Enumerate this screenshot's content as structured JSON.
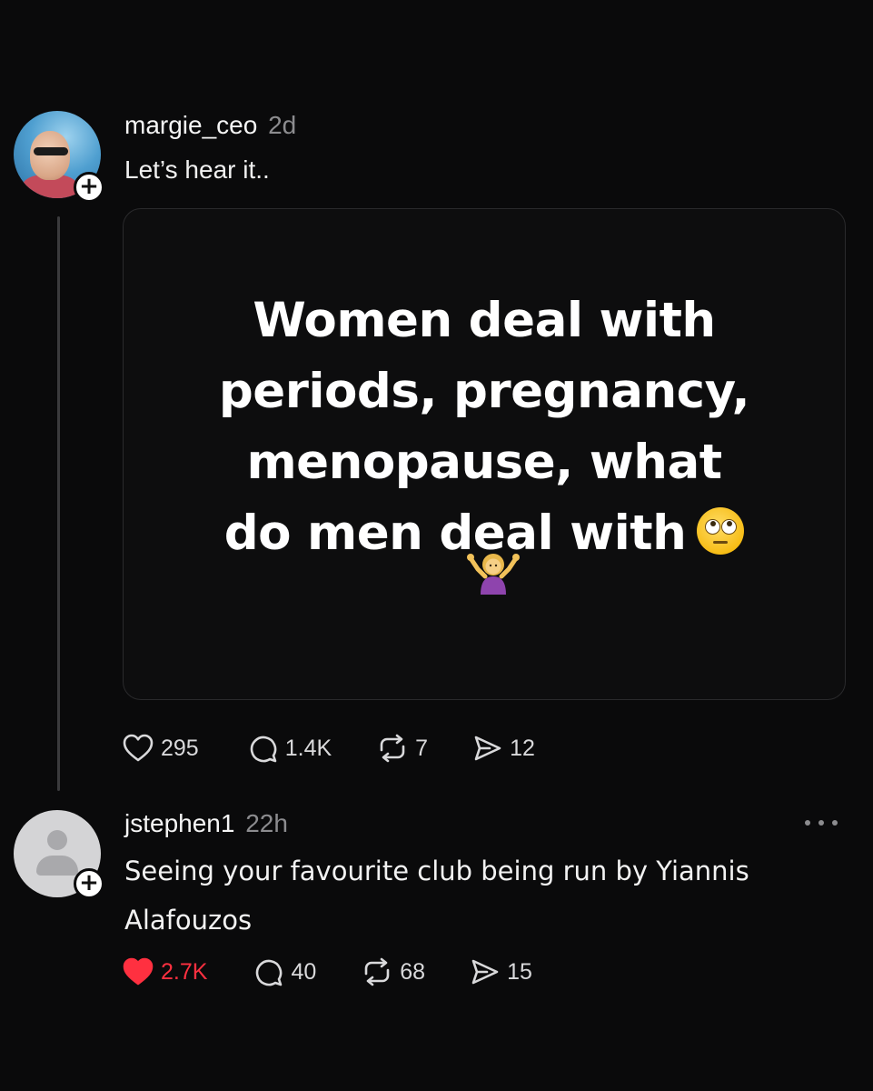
{
  "thread": {
    "post": {
      "username": "margie_ceo",
      "time": "2d",
      "text": "Let’s hear it..",
      "image_text": {
        "line1": "Women deal with",
        "line2": "periods, pregnancy,",
        "line3": "menopause, what",
        "line4": "do men deal with",
        "emojis": [
          "eye-roll-emoji",
          "woman-shrugging-emoji"
        ]
      },
      "stats": {
        "likes": "295",
        "replies": "1.4K",
        "reposts": "7",
        "shares": "12"
      }
    },
    "reply": {
      "username": "jstephen1",
      "time": "22h",
      "text": "Seeing your favourite club being run by Yiannis Alafouzos",
      "liked": true,
      "stats": {
        "likes": "2.7K",
        "replies": "40",
        "reposts": "68",
        "shares": "15"
      }
    }
  },
  "colors": {
    "background": "#0a0a0b",
    "liked_red": "#ff3040",
    "muted_text": "#8c8c8f"
  },
  "icons": [
    "heart-icon",
    "comment-icon",
    "repost-icon",
    "share-icon",
    "more-icon",
    "follow-plus-icon"
  ]
}
